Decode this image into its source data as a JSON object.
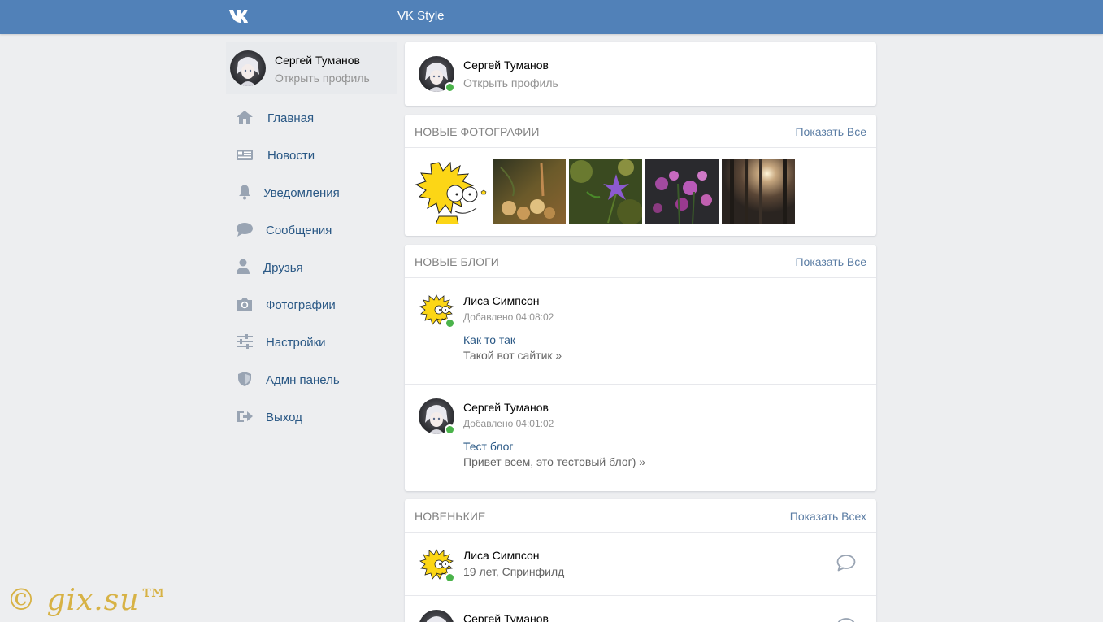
{
  "header": {
    "title": "VK Style",
    "logo_icon": "vk-logo-icon"
  },
  "user": {
    "name": "Сергей Туманов",
    "open_profile": "Открыть профиль"
  },
  "sidebar": {
    "items": [
      {
        "label": "Главная",
        "icon": "home-icon"
      },
      {
        "label": "Новости",
        "icon": "news-icon"
      },
      {
        "label": "Уведомления",
        "icon": "bell-icon"
      },
      {
        "label": "Сообщения",
        "icon": "message-icon"
      },
      {
        "label": "Друзья",
        "icon": "person-icon"
      },
      {
        "label": "Фотографии",
        "icon": "camera-icon"
      },
      {
        "label": "Настройки",
        "icon": "sliders-icon"
      },
      {
        "label": "Адмн панель",
        "icon": "shield-icon"
      },
      {
        "label": "Выход",
        "icon": "logout-icon"
      }
    ]
  },
  "photos": {
    "title": "НОВЫЕ ФОТОГРАФИИ",
    "show_all": "Показать Все"
  },
  "blogs": {
    "title": "НОВЫЕ БЛОГИ",
    "show_all": "Показать Все",
    "items": [
      {
        "author": "Лиса Симпсон",
        "added": "Добавлено 04:08:02",
        "title": "Как то так",
        "excerpt": "Такой вот сайтик »"
      },
      {
        "author": "Сергей Туманов",
        "added": "Добавлено 04:01:02",
        "title": "Тест блог",
        "excerpt": "Привет всем, это тестовый блог) »"
      }
    ]
  },
  "newcomers": {
    "title": "НОВЕНЬКИЕ",
    "show_all": "Показать Всех",
    "items": [
      {
        "name": "Лиса Симпсон",
        "info": "19 лет, Спринфилд"
      },
      {
        "name": "Сергей Туманов",
        "info": ""
      }
    ]
  },
  "watermark": "© gix.su™",
  "colors": {
    "header": "#5181b8",
    "background": "#edeef0",
    "link": "#2a5885",
    "online": "#4bb34b"
  }
}
